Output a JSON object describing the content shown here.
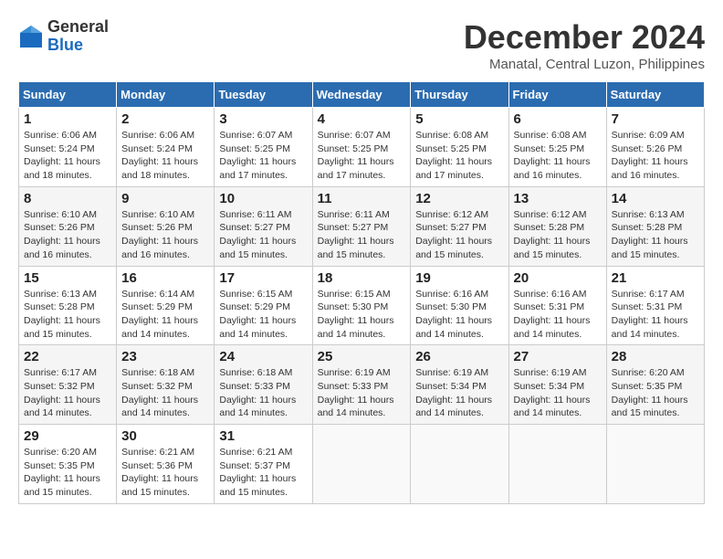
{
  "header": {
    "logo": {
      "line1": "General",
      "line2": "Blue"
    },
    "title": "December 2024",
    "location": "Manatal, Central Luzon, Philippines"
  },
  "weekdays": [
    "Sunday",
    "Monday",
    "Tuesday",
    "Wednesday",
    "Thursday",
    "Friday",
    "Saturday"
  ],
  "weeks": [
    [
      {
        "day": "1",
        "sunrise": "6:06 AM",
        "sunset": "5:24 PM",
        "daylight": "11 hours and 18 minutes."
      },
      {
        "day": "2",
        "sunrise": "6:06 AM",
        "sunset": "5:24 PM",
        "daylight": "11 hours and 18 minutes."
      },
      {
        "day": "3",
        "sunrise": "6:07 AM",
        "sunset": "5:25 PM",
        "daylight": "11 hours and 17 minutes."
      },
      {
        "day": "4",
        "sunrise": "6:07 AM",
        "sunset": "5:25 PM",
        "daylight": "11 hours and 17 minutes."
      },
      {
        "day": "5",
        "sunrise": "6:08 AM",
        "sunset": "5:25 PM",
        "daylight": "11 hours and 17 minutes."
      },
      {
        "day": "6",
        "sunrise": "6:08 AM",
        "sunset": "5:25 PM",
        "daylight": "11 hours and 16 minutes."
      },
      {
        "day": "7",
        "sunrise": "6:09 AM",
        "sunset": "5:26 PM",
        "daylight": "11 hours and 16 minutes."
      }
    ],
    [
      {
        "day": "8",
        "sunrise": "6:10 AM",
        "sunset": "5:26 PM",
        "daylight": "11 hours and 16 minutes."
      },
      {
        "day": "9",
        "sunrise": "6:10 AM",
        "sunset": "5:26 PM",
        "daylight": "11 hours and 16 minutes."
      },
      {
        "day": "10",
        "sunrise": "6:11 AM",
        "sunset": "5:27 PM",
        "daylight": "11 hours and 15 minutes."
      },
      {
        "day": "11",
        "sunrise": "6:11 AM",
        "sunset": "5:27 PM",
        "daylight": "11 hours and 15 minutes."
      },
      {
        "day": "12",
        "sunrise": "6:12 AM",
        "sunset": "5:27 PM",
        "daylight": "11 hours and 15 minutes."
      },
      {
        "day": "13",
        "sunrise": "6:12 AM",
        "sunset": "5:28 PM",
        "daylight": "11 hours and 15 minutes."
      },
      {
        "day": "14",
        "sunrise": "6:13 AM",
        "sunset": "5:28 PM",
        "daylight": "11 hours and 15 minutes."
      }
    ],
    [
      {
        "day": "15",
        "sunrise": "6:13 AM",
        "sunset": "5:28 PM",
        "daylight": "11 hours and 15 minutes."
      },
      {
        "day": "16",
        "sunrise": "6:14 AM",
        "sunset": "5:29 PM",
        "daylight": "11 hours and 14 minutes."
      },
      {
        "day": "17",
        "sunrise": "6:15 AM",
        "sunset": "5:29 PM",
        "daylight": "11 hours and 14 minutes."
      },
      {
        "day": "18",
        "sunrise": "6:15 AM",
        "sunset": "5:30 PM",
        "daylight": "11 hours and 14 minutes."
      },
      {
        "day": "19",
        "sunrise": "6:16 AM",
        "sunset": "5:30 PM",
        "daylight": "11 hours and 14 minutes."
      },
      {
        "day": "20",
        "sunrise": "6:16 AM",
        "sunset": "5:31 PM",
        "daylight": "11 hours and 14 minutes."
      },
      {
        "day": "21",
        "sunrise": "6:17 AM",
        "sunset": "5:31 PM",
        "daylight": "11 hours and 14 minutes."
      }
    ],
    [
      {
        "day": "22",
        "sunrise": "6:17 AM",
        "sunset": "5:32 PM",
        "daylight": "11 hours and 14 minutes."
      },
      {
        "day": "23",
        "sunrise": "6:18 AM",
        "sunset": "5:32 PM",
        "daylight": "11 hours and 14 minutes."
      },
      {
        "day": "24",
        "sunrise": "6:18 AM",
        "sunset": "5:33 PM",
        "daylight": "11 hours and 14 minutes."
      },
      {
        "day": "25",
        "sunrise": "6:19 AM",
        "sunset": "5:33 PM",
        "daylight": "11 hours and 14 minutes."
      },
      {
        "day": "26",
        "sunrise": "6:19 AM",
        "sunset": "5:34 PM",
        "daylight": "11 hours and 14 minutes."
      },
      {
        "day": "27",
        "sunrise": "6:19 AM",
        "sunset": "5:34 PM",
        "daylight": "11 hours and 14 minutes."
      },
      {
        "day": "28",
        "sunrise": "6:20 AM",
        "sunset": "5:35 PM",
        "daylight": "11 hours and 15 minutes."
      }
    ],
    [
      {
        "day": "29",
        "sunrise": "6:20 AM",
        "sunset": "5:35 PM",
        "daylight": "11 hours and 15 minutes."
      },
      {
        "day": "30",
        "sunrise": "6:21 AM",
        "sunset": "5:36 PM",
        "daylight": "11 hours and 15 minutes."
      },
      {
        "day": "31",
        "sunrise": "6:21 AM",
        "sunset": "5:37 PM",
        "daylight": "11 hours and 15 minutes."
      },
      null,
      null,
      null,
      null
    ]
  ]
}
